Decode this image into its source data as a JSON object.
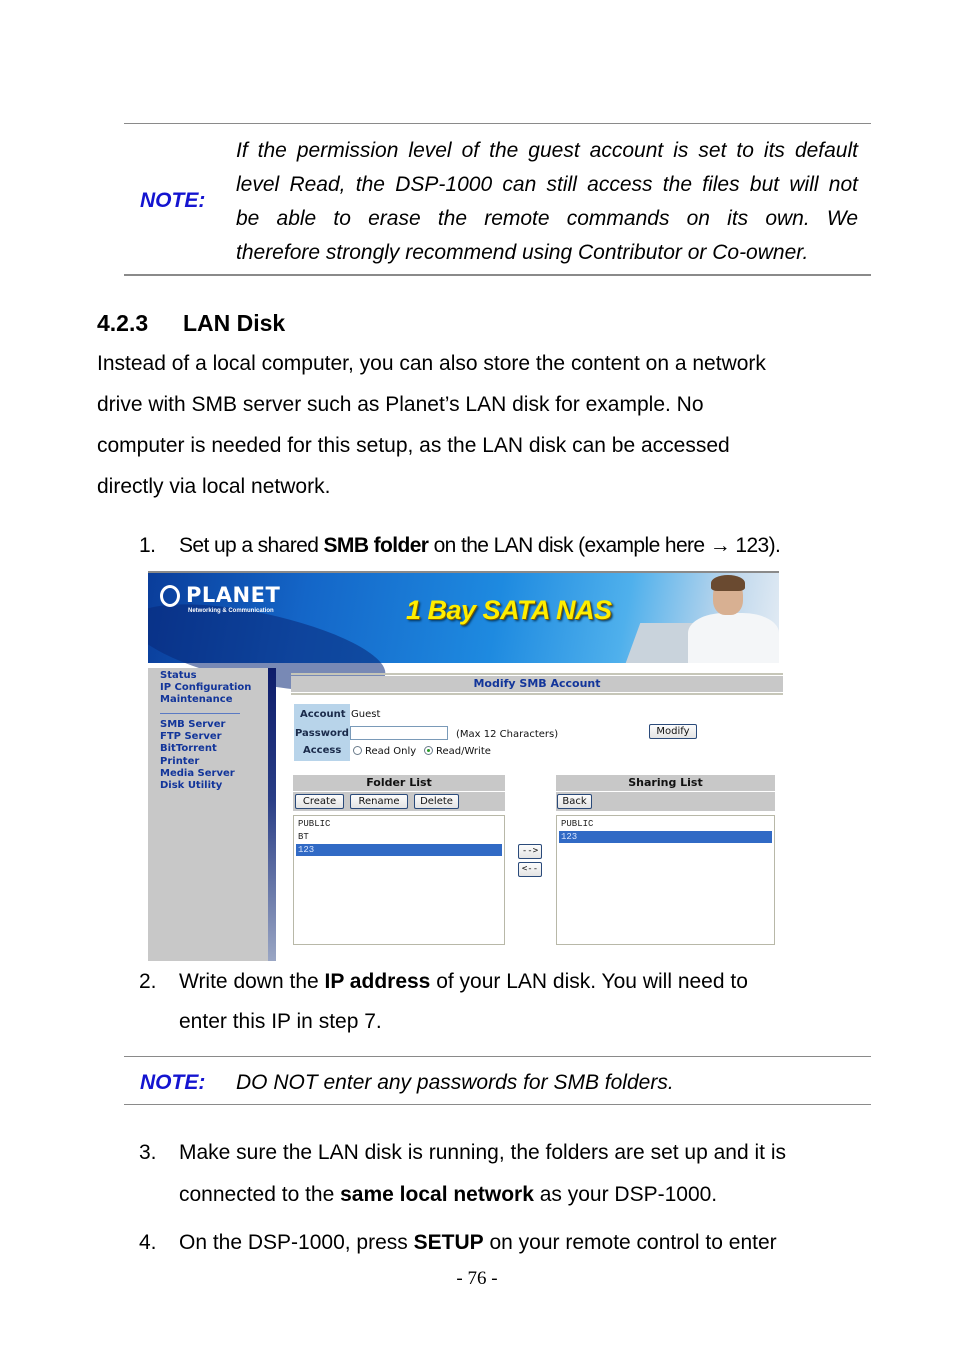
{
  "note1": {
    "label": "NOTE:",
    "lines": [
      "If the permission level of the guest account is set to its default",
      "level Read, the DSP-1000 can still access the files but will not",
      "be able to erase the remote commands on its own. We",
      "therefore strongly recommend using Contributor or Co-owner."
    ]
  },
  "section": {
    "number": "4.2.3",
    "title": "LAN Disk",
    "paragraph_lines": [
      "Instead of a local computer, you can also store the content on a network",
      "drive with SMB server such as Planet’s LAN disk for example. No",
      "computer is needed for this setup, as the LAN disk can be accessed",
      "directly via local network."
    ]
  },
  "steps": [
    {
      "num": "1.",
      "pre": "Set up a shared ",
      "bold": "SMB folder",
      "post": " on the LAN disk (example here → 123)."
    },
    {
      "num": "2.",
      "pre": "Write down the ",
      "bold": "IP address",
      "post": " of your LAN disk. You will need to",
      "line2": "enter this IP in step 7."
    },
    {
      "num": "3.",
      "line1": "Make sure the LAN disk is running, the folders are set up and it is",
      "pre": "connected to the ",
      "bold": "same local network",
      "post": " as your DSP-1000."
    },
    {
      "num": "4.",
      "pre": "On the DSP-1000, press ",
      "bold": "SETUP",
      "post": " on your remote control to enter"
    }
  ],
  "note2": {
    "label": "NOTE:",
    "text": "DO NOT enter any passwords for SMB folders."
  },
  "screenshot": {
    "banner": {
      "brand": "PLANET",
      "brand_sub": "Networking & Communication",
      "product": "1 Bay SATA NAS"
    },
    "sidebar": {
      "group1": [
        "Status",
        "IP Configuration",
        "Maintenance"
      ],
      "group2": [
        "SMB Server",
        "FTP Server",
        "BitTorrent",
        "Printer",
        "Media Server",
        "Disk Utility"
      ]
    },
    "form": {
      "title": "Modify SMB Account",
      "account_label": "Account",
      "account_value": "Guest",
      "password_label": "Password",
      "password_value": "",
      "password_hint": "(Max 12 Characters)",
      "access_label": "Access",
      "access_options": [
        "Read Only",
        "Read/Write"
      ],
      "access_selected": "Read/Write",
      "modify_button": "Modify"
    },
    "folder_list": {
      "title": "Folder List",
      "buttons": [
        "Create",
        "Rename",
        "Delete"
      ],
      "items": [
        "PUBLIC",
        "BT",
        "123"
      ],
      "selected": "123"
    },
    "transfer_buttons": [
      "-->",
      "<--"
    ],
    "sharing_list": {
      "title": "Sharing List",
      "buttons": [
        "Back"
      ],
      "items": [
        "PUBLIC",
        "123"
      ],
      "selected": "123"
    }
  },
  "page_number": "- 76 -"
}
